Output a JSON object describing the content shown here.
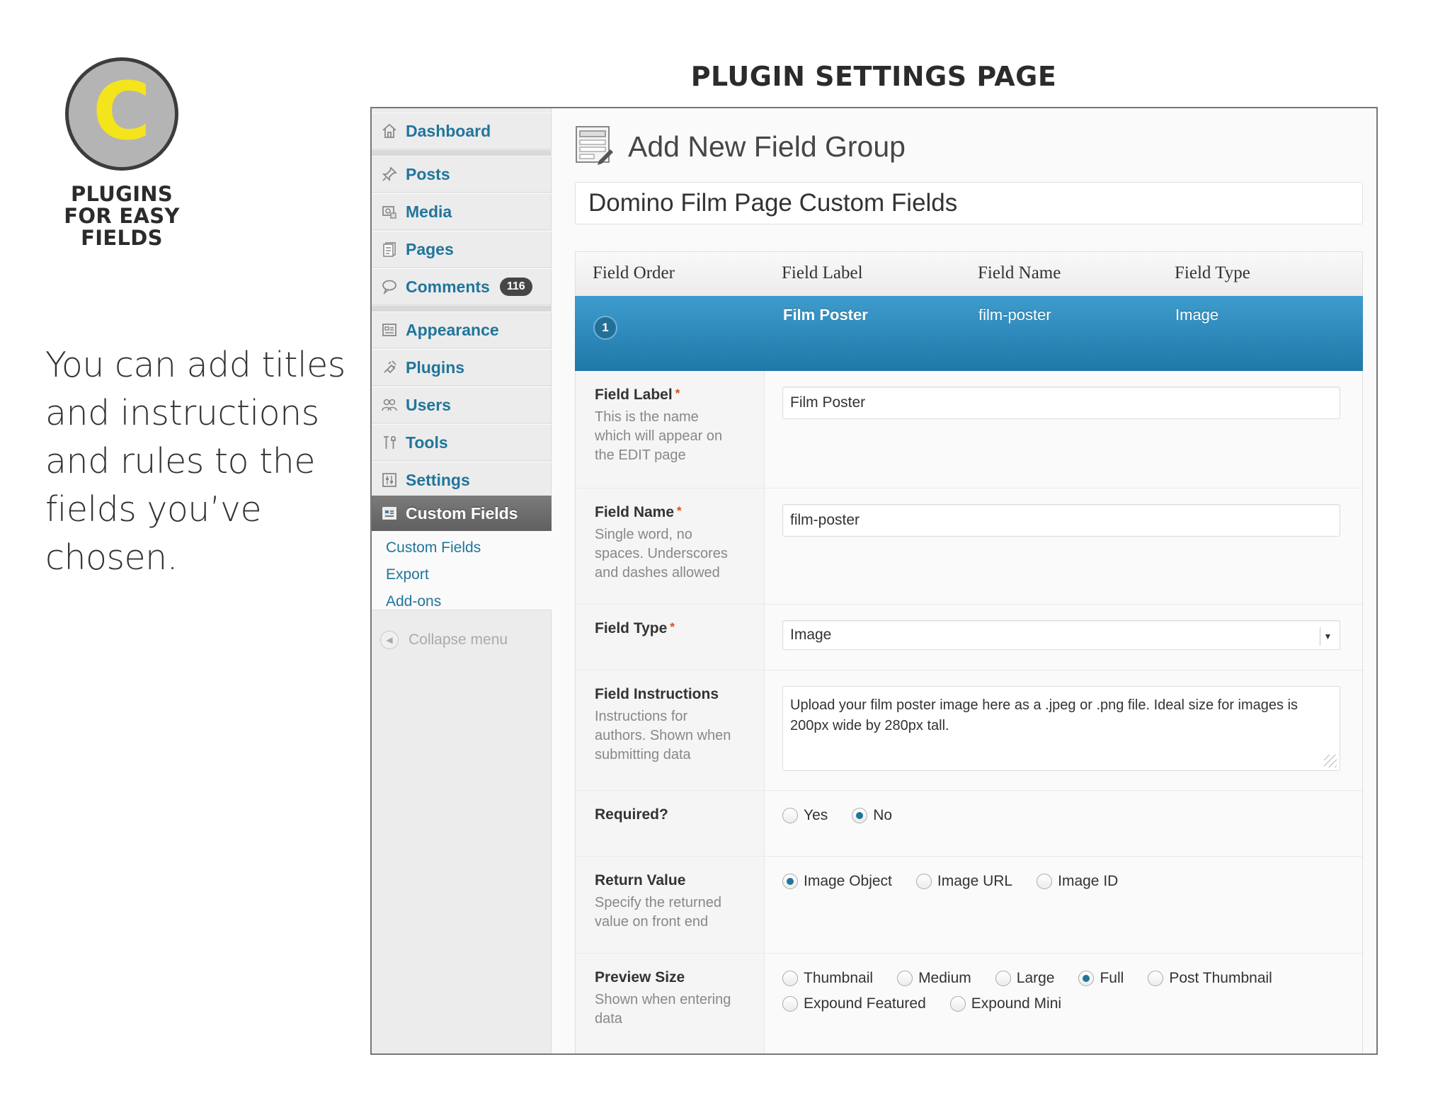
{
  "badge": {
    "letter": "C",
    "caption": "PLUGINS\nFOR EASY\nFIELDS"
  },
  "description": "You can add titles\nand instructions\nand rules to the\nfields you’ve\nchosen.",
  "heading": "PLUGIN SETTINGS PAGE",
  "sidebar": {
    "items": [
      {
        "label": "Dashboard",
        "icon": "home-icon"
      },
      {
        "label": "Posts",
        "icon": "pin-icon"
      },
      {
        "label": "Media",
        "icon": "media-icon"
      },
      {
        "label": "Pages",
        "icon": "pages-icon"
      },
      {
        "label": "Comments",
        "icon": "comment-icon",
        "count": "116"
      },
      {
        "label": "Appearance",
        "icon": "appearance-icon"
      },
      {
        "label": "Plugins",
        "icon": "plugin-icon"
      },
      {
        "label": "Users",
        "icon": "users-icon"
      },
      {
        "label": "Tools",
        "icon": "tools-icon"
      },
      {
        "label": "Settings",
        "icon": "settings-icon"
      }
    ],
    "active": {
      "label": "Custom Fields",
      "icon": "custom-fields-icon"
    },
    "submenu": [
      "Custom Fields",
      "Export",
      "Add-ons"
    ],
    "collapse": "Collapse menu"
  },
  "page_title": "Add New Field Group",
  "group_title": "Domino Film Page Custom Fields",
  "table": {
    "headers": [
      "Field Order",
      "Field Label",
      "Field Name",
      "Field Type"
    ],
    "row": {
      "order": "1",
      "label": "Film Poster",
      "name": "film-poster",
      "type": "Image"
    }
  },
  "settings": {
    "field_label": {
      "label": "Field Label",
      "star": "*",
      "desc": "This is the name\nwhich will appear on\nthe EDIT page",
      "value": "Film Poster"
    },
    "field_name": {
      "label": "Field Name",
      "star": "*",
      "desc": "Single word, no\nspaces. Underscores\nand dashes allowed",
      "value": "film-poster"
    },
    "field_type": {
      "label": "Field Type",
      "star": "*",
      "value": "Image"
    },
    "instructions": {
      "label": "Field Instructions",
      "desc": "Instructions for\nauthors. Shown when\nsubmitting data",
      "value": "Upload your film poster image here as a .jpeg or .png file. Ideal size for images is 200px wide by 280px tall."
    },
    "required": {
      "label": "Required?",
      "options": [
        "Yes",
        "No"
      ],
      "selected": "No"
    },
    "return_value": {
      "label": "Return Value",
      "desc": "Specify the returned\nvalue on front end",
      "options": [
        "Image Object",
        "Image URL",
        "Image ID"
      ],
      "selected": "Image Object"
    },
    "preview_size": {
      "label": "Preview Size",
      "desc": "Shown when entering\ndata",
      "options": [
        "Thumbnail",
        "Medium",
        "Large",
        "Full",
        "Post Thumbnail",
        "Expound Featured",
        "Expound Mini"
      ],
      "selected": "Full"
    }
  },
  "colors": {
    "link": "#21759b",
    "bar": "#2a88ba",
    "badge_fill": "#b4b4b4",
    "badge_letter": "#f4e41c"
  }
}
